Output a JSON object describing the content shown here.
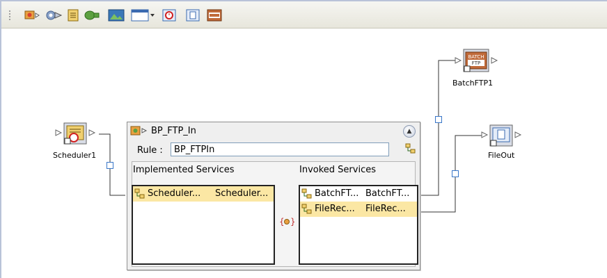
{
  "toolbar": {
    "buttons": [
      {
        "icon": "business-process-icon"
      },
      {
        "icon": "service-icon"
      },
      {
        "icon": "scheduler-icon"
      },
      {
        "icon": "connector-icon"
      },
      {
        "icon": "image-icon"
      },
      {
        "icon": "window-dropdown-icon"
      },
      {
        "icon": "timer-icon"
      },
      {
        "icon": "file-icon"
      },
      {
        "icon": "batch-icon"
      }
    ]
  },
  "nodes": {
    "scheduler": {
      "label": "Scheduler1",
      "icon": "scheduler-icon"
    },
    "batchftp": {
      "label": "BatchFTP1",
      "icon": "batch-ftp-icon",
      "icon_text_top": "BATCH",
      "icon_text_bottom": "FTP"
    },
    "fileout": {
      "label": "FileOut",
      "icon": "file-icon"
    }
  },
  "business_process": {
    "title": "BP_FTP_In",
    "rule_label": "Rule :",
    "rule_value": "BP_FTPIn",
    "implemented": {
      "header": "Implemented Services",
      "rows": [
        {
          "col1": "Scheduler...",
          "col2": "Scheduler..."
        }
      ]
    },
    "invoked": {
      "header": "Invoked Services",
      "rows": [
        {
          "col1": "BatchFT...",
          "col2": "BatchFT...",
          "selected": false
        },
        {
          "col1": "FileRec...",
          "col2": "FileRec...",
          "selected": true
        }
      ]
    }
  },
  "colors": {
    "accent": "#3876c8",
    "row_highlight": "#fbe7a4"
  }
}
